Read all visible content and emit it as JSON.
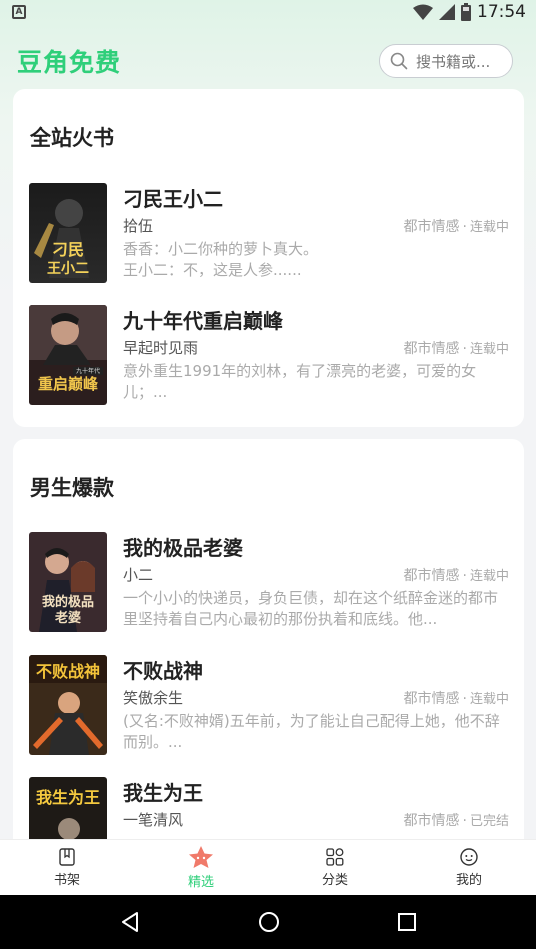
{
  "status_bar": {
    "time": "17:54",
    "indicator": "A"
  },
  "header": {
    "title": "豆角免费",
    "search_placeholder": "搜书籍或..."
  },
  "sections": [
    {
      "title": "全站火书",
      "books": [
        {
          "title": "刁民王小二",
          "author": "拾伍",
          "category": "都市情感",
          "status": "连载中",
          "desc": "香香：小二你种的萝卜真大。\n王小二：不，这是人参......",
          "cover_text": "刁民王小二"
        },
        {
          "title": "九十年代重启巅峰",
          "author": "早起时见雨",
          "category": "都市情感",
          "status": "连载中",
          "desc": "意外重生1991年的刘林，有了漂亮的老婆，可爱的女儿；...",
          "cover_text": "重启巅峰"
        }
      ]
    },
    {
      "title": "男生爆款",
      "books": [
        {
          "title": "我的极品老婆",
          "author": "小二",
          "category": "都市情感",
          "status": "连载中",
          "desc": "一个小小的快递员，身负巨债，却在这个纸醉金迷的都市里坚持着自己内心最初的那份执着和底线。他...",
          "cover_text": "我的极品老婆"
        },
        {
          "title": "不败战神",
          "author": "笑傲余生",
          "category": "都市情感",
          "status": "连载中",
          "desc": "(又名:不败神婿)五年前，为了能让自己配得上她，他不辞而别。...",
          "cover_text": "不败战神"
        },
        {
          "title": "我生为王",
          "author": "一笔清风",
          "category": "都市情感",
          "status": "已完结",
          "desc": "",
          "cover_text": "我生为王"
        }
      ]
    }
  ],
  "tabs": [
    {
      "label": "书架",
      "icon": "bookshelf-icon"
    },
    {
      "label": "精选",
      "icon": "featured-icon"
    },
    {
      "label": "分类",
      "icon": "category-icon"
    },
    {
      "label": "我的",
      "icon": "profile-icon"
    }
  ],
  "colors": {
    "accent": "#2fcf7a",
    "muted": "#aaaaaa",
    "text": "#222222"
  }
}
